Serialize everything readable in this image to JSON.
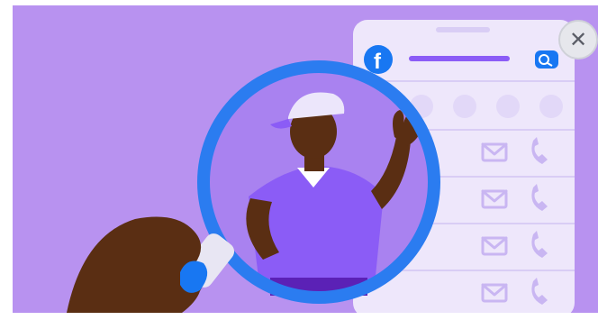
{
  "illustration": {
    "theme": {
      "background": "#b892f0",
      "panel": "#eee7fb",
      "facebook_blue": "#1877f2",
      "lens_rim": "#2b7cf0",
      "person_shirt": "#8b5cf6",
      "skin": "#5a2e13"
    },
    "facebook_logo_glyph": "f",
    "contact_rows": 4
  },
  "close_button": {
    "glyph": "✕",
    "icon": "close-icon"
  }
}
